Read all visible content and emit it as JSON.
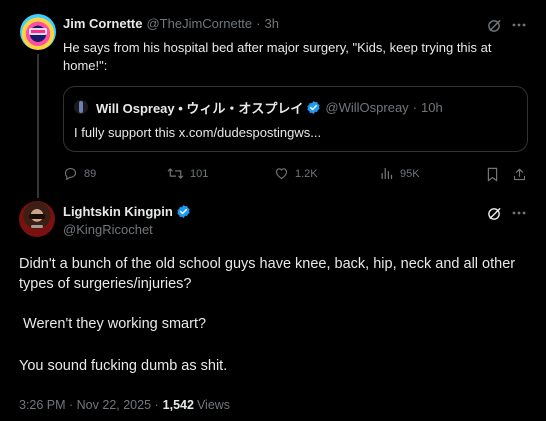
{
  "quoted_tweet": {
    "author_name": "Jim Cornette",
    "handle": "@TheJimCornette",
    "sep": "·",
    "time": "3h",
    "text": "He says from his hospital bed after major surgery, \"Kids, keep trying this at home!\":",
    "quote": {
      "author_name": "Will Ospreay • ウィル・オスプレイ",
      "handle": "@WillOspreay",
      "sep": "·",
      "time": "10h",
      "text": "I fully support this x.com/dudespostingws..."
    },
    "actions": {
      "replies": "89",
      "reposts": "101",
      "likes": "1.2K",
      "views": "95K"
    }
  },
  "main_tweet": {
    "author_name": "Lightskin Kingpin",
    "handle": "@KingRicochet",
    "paragraphs": [
      "Didn't a bunch of the old school guys have knee, back, hip, neck and all other types of surgeries/injuries?",
      " Weren't they working smart?",
      "You sound fucking dumb as shit."
    ],
    "timestamp": "3:26 PM · Nov 22, 2025 ·",
    "views_count": "1,542",
    "views_label": "Views"
  },
  "colors": {
    "background": "#000000",
    "text": "#e7e9ea",
    "muted": "#71767b",
    "verified": "#1d9bf0",
    "border": "#2f3336"
  }
}
